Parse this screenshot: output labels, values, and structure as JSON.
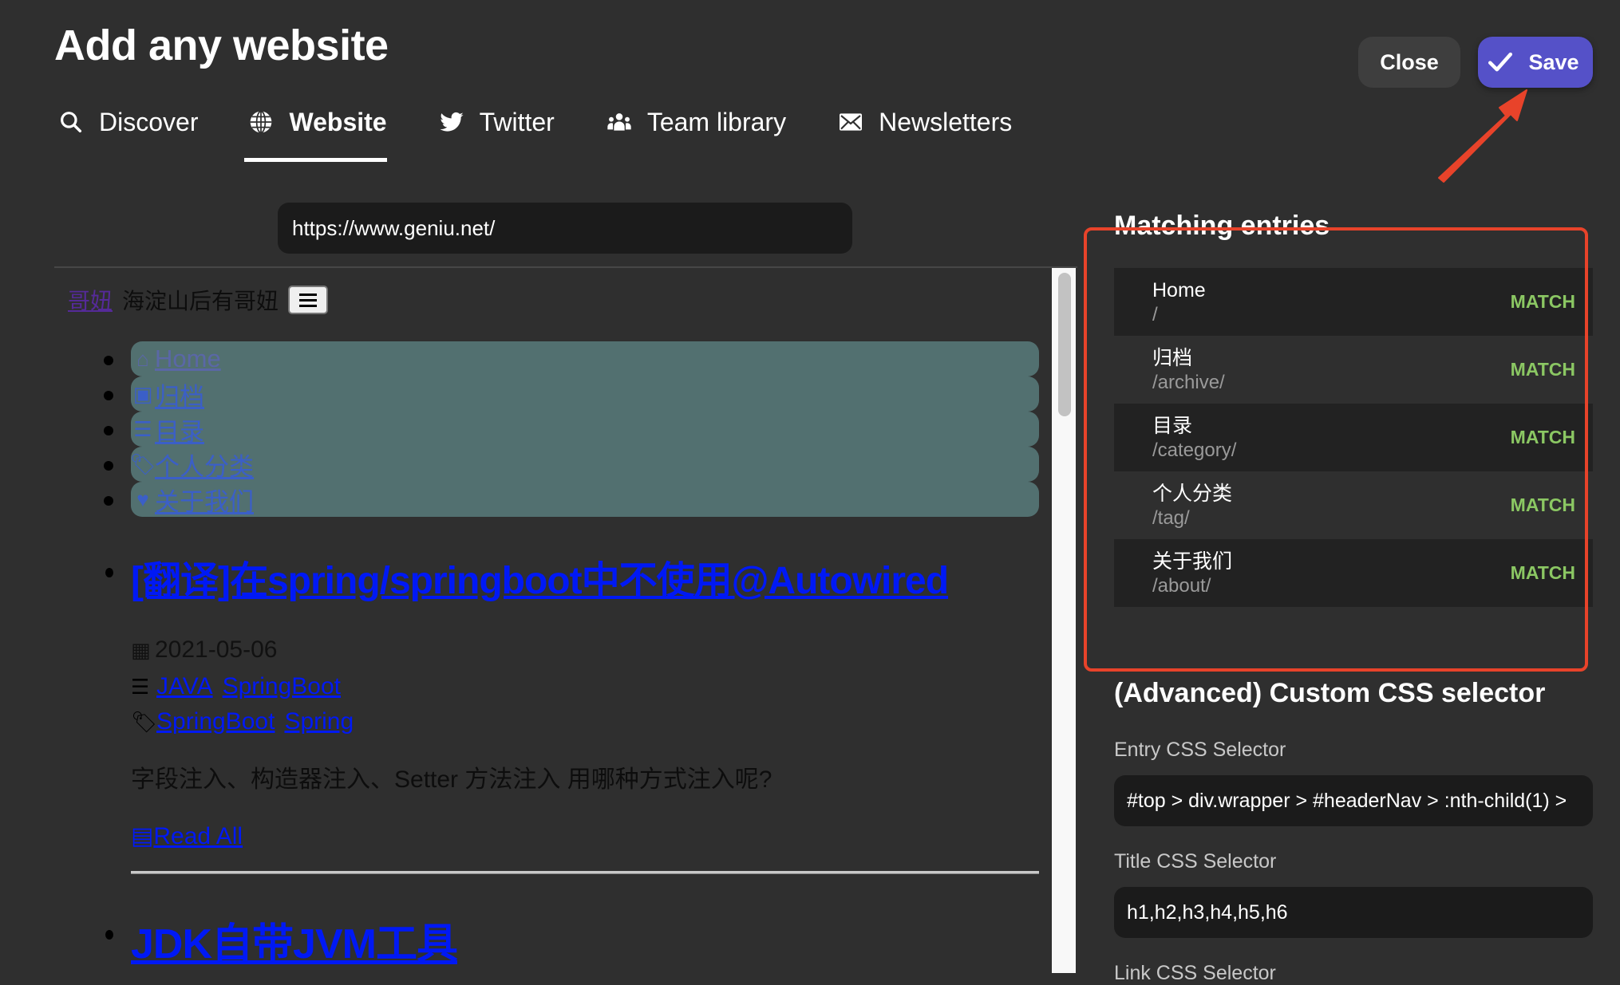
{
  "header": {
    "title": "Add any website",
    "close_label": "Close",
    "save_label": "Save"
  },
  "tabs": [
    {
      "label": "Discover",
      "icon": "search-icon",
      "active": false
    },
    {
      "label": "Website",
      "icon": "globe-icon",
      "active": true
    },
    {
      "label": "Twitter",
      "icon": "twitter-icon",
      "active": false
    },
    {
      "label": "Team library",
      "icon": "users-icon",
      "active": false
    },
    {
      "label": "Newsletters",
      "icon": "envelope-icon",
      "active": false
    }
  ],
  "url_input": {
    "value": "https://www.geniu.net/"
  },
  "preview": {
    "brand": "哥妞",
    "tagline": "海淀山后有哥妞",
    "nav": [
      {
        "icon": "home-icon",
        "label": "Home"
      },
      {
        "icon": "archive-icon",
        "label": "归档"
      },
      {
        "icon": "list-icon",
        "label": "目录"
      },
      {
        "icon": "tags-icon",
        "label": "个人分类"
      },
      {
        "icon": "heart-icon",
        "label": "关于我们"
      }
    ],
    "article": {
      "title": "[翻译]在spring/springboot中不使用@Autowired",
      "date": "2021-05-06",
      "categories": [
        "JAVA",
        "SpringBoot"
      ],
      "tags": [
        "SpringBoot",
        "Spring"
      ],
      "excerpt": "字段注入、构造器注入、Setter 方法注入 用哪种方式注入呢?",
      "read_all": "Read All"
    },
    "article2": {
      "title": "JDK自带JVM工具"
    }
  },
  "matching": {
    "title": "Matching entries",
    "entries": [
      {
        "title": "Home",
        "path": "/",
        "status": "MATCH"
      },
      {
        "title": "归档",
        "path": "/archive/",
        "status": "MATCH"
      },
      {
        "title": "目录",
        "path": "/category/",
        "status": "MATCH"
      },
      {
        "title": "个人分类",
        "path": "/tag/",
        "status": "MATCH"
      },
      {
        "title": "关于我们",
        "path": "/about/",
        "status": "MATCH"
      }
    ]
  },
  "advanced": {
    "title": "(Advanced) Custom CSS selector",
    "entry_label": "Entry CSS Selector",
    "entry_value": "#top > div.wrapper > #headerNav > :nth-child(1) >",
    "title_label": "Title CSS Selector",
    "title_value": "h1,h2,h3,h4,h5,h6",
    "link_label": "Link CSS Selector"
  },
  "colors": {
    "accent": "#5551c8",
    "match": "#8bc763",
    "annotation": "#e8432a",
    "background": "#2f2f2f"
  }
}
